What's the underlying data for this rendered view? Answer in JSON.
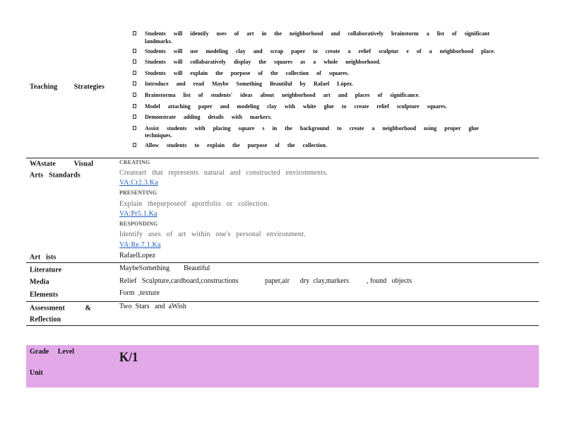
{
  "teaching": {
    "label": "Teaching         Strategies",
    "items": [
      {
        "line1": "Students will identify uses of art in the neighborhood and collaboratively brainstorm a list of significant",
        "line2": "landmarks."
      },
      {
        "line1": "Students will use modeling clay and scrap paper to create a relief sculptur e of a neighborhood place."
      },
      {
        "line1": "Students will collabaratively display the squares as a whole neighborhood."
      },
      {
        "line1": "Students will explain the purpose of the collection of squares."
      },
      {
        "line1": "Introduce and read Maybe Something Beautiful by Rafael López."
      },
      {
        "line1": "Brainstorma list of students' ideas about neighborhood art and places of significance."
      },
      {
        "line1": "Model attaching paper and modeling clay with white glue to create relief sculpture squares."
      },
      {
        "line1": "Demonstrate adding details with markers."
      },
      {
        "line1": "Assist students with placing square s in the background to create a neighborhood using proper glue",
        "line2": "techniques."
      },
      {
        "line1": "Allow students to explain the purpose of the collection."
      }
    ]
  },
  "standards": {
    "label1": "WAstate          Visual",
    "label2": "Arts   Standards",
    "creating_head": "CREATING",
    "creating_text": "Createart that represents natural and constructed environments.",
    "creating_code": "VA:Cr2.3.Ka",
    "presenting_head": "PRESENTING",
    "presenting_text": "Explain thepurposeof aportfolio or collection.",
    "presenting_code": "VA:Pr5.1.Ka",
    "responding_head": "RESPONDING",
    "responding_text": "Identify uses of art within one's personal environment.",
    "responding_code": "VA:Re.7.1.Ka"
  },
  "artists": {
    "label": "Art   ists",
    "value": "RafaelLopez"
  },
  "literature": {
    "label": "Literature",
    "value": "MaybeSomething        Beautiful"
  },
  "media": {
    "label": "Media",
    "value": "Relief   Sculpture,cardboard,constructions               paper,air      dry  clay,markers          , found   objects"
  },
  "elements": {
    "label": "Elements",
    "value": "Form  ,texture"
  },
  "assessment": {
    "label1": "Assessment           &",
    "label2": "Reflection",
    "value": "Two  Stars   and  aWish"
  },
  "grade": {
    "label": "Grade     Level",
    "unit_label": "Unit",
    "value": "K/1"
  },
  "colors": {
    "grade_band": "#e2a8e8",
    "link": "#1f5fb8",
    "muted_text": "#666666"
  }
}
